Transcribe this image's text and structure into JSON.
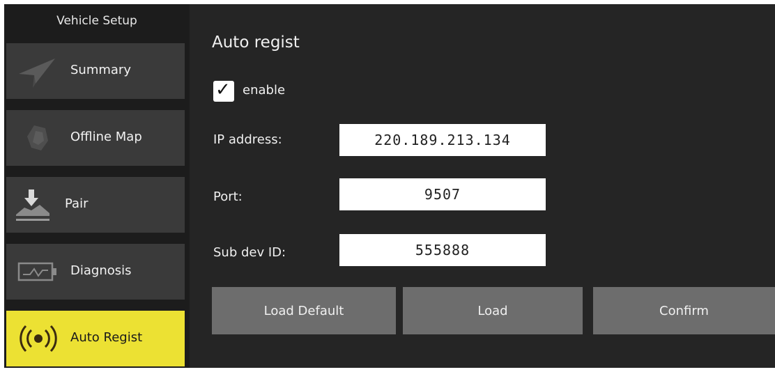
{
  "sidebar": {
    "title": "Vehicle Setup",
    "items": [
      {
        "label": "Summary",
        "icon": "paper-plane-icon",
        "active": false
      },
      {
        "label": "Offline Map",
        "icon": "map-icon",
        "active": false
      },
      {
        "label": "Pair",
        "icon": "download-pair-icon",
        "active": false
      },
      {
        "label": "Diagnosis",
        "icon": "battery-pulse-icon",
        "active": false
      },
      {
        "label": "Auto Regist",
        "icon": "radio-signal-icon",
        "active": true
      }
    ]
  },
  "panel": {
    "title": "Auto regist",
    "enable": {
      "label": "enable",
      "checked": true,
      "check_glyph": "✓"
    },
    "ip": {
      "label": "IP address:",
      "value": "220.189.213.134"
    },
    "port": {
      "label": "Port:",
      "value": "9507"
    },
    "sub_dev": {
      "label": "Sub dev ID:",
      "value": "555888"
    },
    "buttons": {
      "load_default": "Load Default",
      "load": "Load",
      "confirm": "Confirm"
    }
  },
  "colors": {
    "background": "#252525",
    "sidebar": "#1c1c1c",
    "nav_item": "#3a3a3a",
    "active_accent": "#ece133",
    "button": "#6d6d6d"
  }
}
